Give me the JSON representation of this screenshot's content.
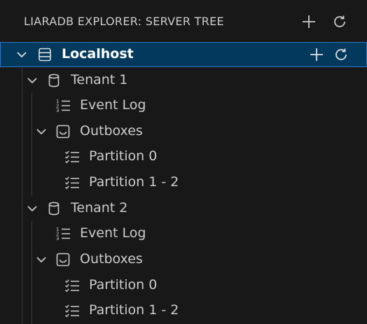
{
  "header": {
    "title": "LIARADB EXPLORER: SERVER TREE",
    "add_icon": "plus-icon",
    "refresh_icon": "refresh-icon"
  },
  "tree": {
    "server": {
      "label": "Localhost",
      "icon": "server-icon",
      "expanded": true
    },
    "tenants": [
      {
        "label": "Tenant 1",
        "icon": "database-icon",
        "event_log": {
          "label": "Event Log",
          "icon": "ordered-list-icon"
        },
        "outboxes": {
          "label": "Outboxes",
          "icon": "inbox-icon",
          "partitions": [
            {
              "label": "Partition 0",
              "icon": "checklist-icon"
            },
            {
              "label": "Partition 1 - 2",
              "icon": "checklist-icon"
            }
          ]
        }
      },
      {
        "label": "Tenant 2",
        "icon": "database-icon",
        "event_log": {
          "label": "Event Log",
          "icon": "ordered-list-icon"
        },
        "outboxes": {
          "label": "Outboxes",
          "icon": "inbox-icon",
          "partitions": [
            {
              "label": "Partition 0",
              "icon": "checklist-icon"
            },
            {
              "label": "Partition 1 - 2",
              "icon": "checklist-icon"
            }
          ]
        }
      }
    ]
  },
  "colors": {
    "background": "#181818",
    "selection": "#04395e",
    "selection_border": "#2b79c2",
    "text": "#cccccc"
  }
}
